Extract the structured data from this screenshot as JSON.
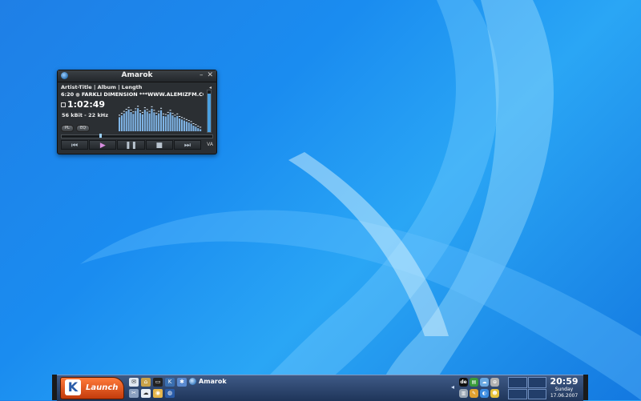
{
  "amarok": {
    "title": "Amarok",
    "columns": "Artist-Title | Album | Length",
    "track_position": "6:20",
    "track_title": "FARKLI DIMENSION ***WWW.ALEMIZFM.CC",
    "elapsed": "1:02:49",
    "bitrate": "56 kBit - 22 kHz",
    "pl_label": "PL",
    "eq_label": "EQ",
    "volume_level": 0.92,
    "seek_fraction": 0.25,
    "va_label": "VA",
    "controls": {
      "prev": "⏮",
      "play": "▶",
      "pause": "❚❚",
      "stop": "■",
      "next": "⏭"
    },
    "analyzer_levels": [
      0.55,
      0.62,
      0.7,
      0.78,
      0.85,
      0.75,
      0.68,
      0.8,
      0.9,
      0.72,
      0.66,
      0.84,
      0.77,
      0.7,
      0.88,
      0.74,
      0.63,
      0.7,
      0.82,
      0.6,
      0.58,
      0.66,
      0.74,
      0.62,
      0.55,
      0.6,
      0.5,
      0.46,
      0.42,
      0.38,
      0.34,
      0.3,
      0.22,
      0.18,
      0.12,
      0.08
    ],
    "analyzer_color": "#7fb4e6"
  },
  "taskbar": {
    "launch_label": "Launch",
    "task_amarok": "Amarok",
    "tray_lang": "de",
    "clock_time": "20:59",
    "clock_day": "Sunday",
    "clock_date": "17.06.2007"
  }
}
